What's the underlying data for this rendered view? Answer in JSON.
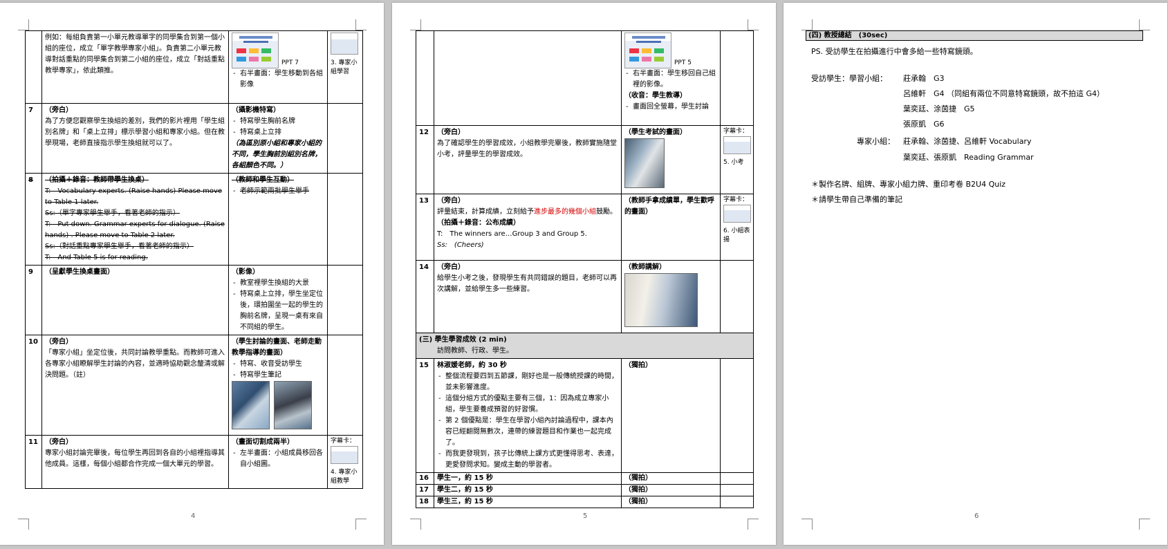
{
  "pages": {
    "p4": {
      "page_number": "4",
      "row_intro": {
        "text": "例如：每組負責第一小單元教導單字的同學集合到第一個小組的座位，成立「單字教學專家小組」。負責第二小單元教導對話重點的同學集合到第二小組的座位，成立「對話重點教學專家」，依此類推。",
        "ppt_label": "PPT 7",
        "media": "右半畫面：學生移動到各組影像",
        "side": "3. 專家小組學習"
      },
      "r7": {
        "num": "7",
        "head": "（旁白）",
        "text": "為了方便您觀察學生換組的差別，我們的影片裡用「學生組別名牌」和「桌上立排」標示學習小組和專家小組。但在教學現場，老師直接指示學生換組就可以了。",
        "media_head": "（攝影機特寫）",
        "media_items": [
          "特寫學生胸前名牌",
          "特寫桌上立排"
        ],
        "media_note": "（為區別原小組和專家小組的不同，學生胸前別組別名牌，各組顏色不同。）"
      },
      "r8": {
        "num": "8",
        "head": "（拍攝＋錄音：教師帶學生換桌）",
        "lines": [
          "T:　Vocabulary experts. (Raise hands) Please move to Table 1 later.",
          "Ss:（單字專家學生舉手，看著老師的指示）",
          "T:　Put down. Grammar experts for dialogue. (Raise hands) . Please move to Table 2 later.",
          "Ss:（對話重點專家學生舉手，看著老師的指示）",
          "T:　And Table 5 is for reading."
        ],
        "media_head": "（教師和學生互動）",
        "media_items": [
          "老師示範兩批學生舉手"
        ]
      },
      "r9": {
        "num": "9",
        "head": "（呈獻學生換桌畫面）",
        "media_head": "（影像）",
        "media_items": [
          "教室裡學生換組的大景",
          "特寫桌上立排，學生坐定位後，環拍圍坐一起的學生的胸前名牌，呈現一桌有來自不同組的學生。"
        ]
      },
      "r10": {
        "num": "10",
        "head": "（旁白）",
        "text": "「專家小組」坐定位後，共同討論教學重點。而教師可進入各專家小組瞭解學生討論的內容，並適時協助觀念釐清或解決問題。（註）",
        "media_head": "（學生討論的畫面、老師走動教學指導的畫面）",
        "media_items": [
          "特寫、收音受訪學生",
          "特寫學生筆記"
        ]
      },
      "r11": {
        "num": "11",
        "head": "（旁白）",
        "text": "專家小組討論完畢後，每位學生再回到各自的小組裡指導其他成員。這樣，每個小組都合作完成一個大單元的學習。",
        "media_head": "（畫面切割成兩半）",
        "media_items": [
          "左半畫面：小組成員移回各自小組圖。"
        ],
        "side_top": "字幕卡：",
        "side": "4. 專家小組教學"
      }
    },
    "p5": {
      "page_number": "5",
      "row_top": {
        "ppt_label": "PPT 5",
        "media_items": [
          "右半畫面：學生移回自己組裡的影像。"
        ],
        "media_head2": "（收音：學生教導）",
        "media_items2": [
          "畫面回全螢幕，學生討論"
        ]
      },
      "r12": {
        "num": "12",
        "head": "（旁白）",
        "text": "為了確認學生的學習成效，小組教學完畢後，教師實施隨堂小考，評量學生的學習成效。",
        "media_head": "（學生考試的畫面）",
        "side_top": "字幕卡：",
        "side": "5. 小考"
      },
      "r13": {
        "num": "13",
        "head": "（旁白）",
        "text_a": "評量結束，計算成績，立刻給予",
        "text_red": "進步最多的幾個小組",
        "text_b": "鼓勵。",
        "sub_head": "（拍攝＋錄音：公布成績）",
        "line1": "T:　The winners are…Group 3 and Group 5.",
        "line2": "Ss:　(Cheers)",
        "media_head": "（教師手拿成績單，學生歡呼的畫面）",
        "side_top": "字幕卡：",
        "side": "6. 小組表揚"
      },
      "r14": {
        "num": "14",
        "head": "（旁白）",
        "text": "給學生小考之後，發現學生有共同錯誤的題目，老師可以再次講解，並給學生多一些練習。",
        "media_head": "（教師講解）"
      },
      "section3": {
        "title": "(三) 學生學習成效 (2 min)",
        "sub": "訪問教師、行政、學生。"
      },
      "r15": {
        "num": "15",
        "head": "林淑媛老師，約 30 秒",
        "items": [
          "整個流程要四到五節課，剛好也是一般傳統授課的時間，並未影響進度。",
          "這個分組方式的優點主要有三個，1：因為成立專家小組，學生要養成預習的好習慣。",
          "第 2 個優點是：學生在學習小組內討論過程中，課本內容已經翻閱無數次，連帶的練習題目和作業也一起完成了。",
          "而我更發現到，孩子比傳統上課方式更懂得思考、表達，更愛發問求知。變成主動的學習者。"
        ],
        "media_head": "（獨拍）"
      },
      "r16": {
        "num": "16",
        "head": "學生一，約 15 秒",
        "media_head": "（獨拍）"
      },
      "r17": {
        "num": "17",
        "head": "學生二，約 15 秒",
        "media_head": "（獨拍）"
      },
      "r18": {
        "num": "18",
        "head": "學生三，約 15 秒",
        "media_head": "（獨拍）"
      }
    },
    "p6": {
      "page_number": "6",
      "section4": "(四) 教授總結　(30sec)",
      "ps": "PS. 受訪學生在拍攝進行中會多給一些特寫鏡頭。",
      "study_label": "受訪學生：學習小組：",
      "study_lines": [
        "莊承翰　G3",
        "呂維軒　G4 （同組有兩位不同意特寫鏡頭，故不拍這 G4）",
        "葉奕廷、涂茵捷　G5",
        "張原凱　G6"
      ],
      "expert_label": "專家小組：",
      "expert_lines": [
        "莊承翰、涂茵捷、呂維軒 Vocabulary",
        "葉奕廷、張原凱　Reading Grammar"
      ],
      "notes": [
        "＊製作名牌、組牌、專家小組力牌、重印考卷 B2U4 Quiz",
        "＊請學生帶自己準備的筆記"
      ]
    }
  }
}
